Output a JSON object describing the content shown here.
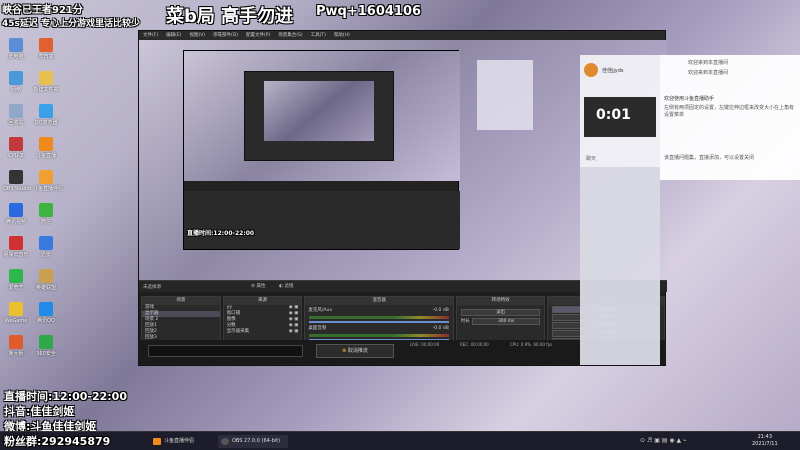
{
  "stream_overlay": {
    "rank_line": "峡谷已王者921分",
    "delay_line": "45s延迟 专心上分游戏里话比较少",
    "title_big": "菜b局 高手勿进",
    "qq_group": "Pwq+1604106",
    "schedule": "直播时间:12:00-22:00",
    "douyin": "抖音:佳佳剑姬",
    "weibo": "微博:斗鱼佳佳剑姬",
    "fans": "粉丝群:292945879"
  },
  "desktop_icons": [
    {
      "label": "此电脑",
      "color": "#5a8fd8"
    },
    {
      "label": "向日葵",
      "color": "#e06030"
    },
    {
      "label": "网络",
      "color": "#4a9ad8"
    },
    {
      "label": "新建文件夹",
      "color": "#e8c050"
    },
    {
      "label": "回收站",
      "color": "#8fa8c8"
    },
    {
      "label": "QQ浏览器",
      "color": "#3aa0e8"
    },
    {
      "label": "CPU-Z",
      "color": "#c03a3a"
    },
    {
      "label": "斗鱼直播",
      "color": "#f08a1e"
    },
    {
      "label": "OBS Studio",
      "color": "#333"
    },
    {
      "label": "斗鱼直播伴侣",
      "color": "#f0a030"
    },
    {
      "label": "腾讯视频",
      "color": "#2a6ae0"
    },
    {
      "label": "微信",
      "color": "#3fb33f"
    },
    {
      "label": "网易云音乐",
      "color": "#d03030"
    },
    {
      "label": "迅雷",
      "color": "#3a7ae0"
    },
    {
      "label": "爱奇艺",
      "color": "#2fb84a"
    },
    {
      "label": "英雄联盟",
      "color": "#c8a050"
    },
    {
      "label": "WeGame",
      "color": "#e8c030"
    },
    {
      "label": "腾讯QQ",
      "color": "#1f8ae8"
    },
    {
      "label": "鲁大师",
      "color": "#e05a2a"
    },
    {
      "label": "360安全",
      "color": "#2fa84a"
    }
  ],
  "obs": {
    "menu": [
      "文件(F)",
      "编辑(E)",
      "视图(V)",
      "停靠部件(D)",
      "配置文件(P)",
      "场景集合(S)",
      "工具(T)",
      "帮助(H)"
    ],
    "status_text": "未选择源",
    "status_btn1": "属性",
    "status_btn2": "滤镜",
    "docks": {
      "scenes_title": "场景",
      "sources_title": "来源",
      "mixer_title": "混音器",
      "transitions_title": "转场特效",
      "controls_title": "控件"
    },
    "scenes": [
      "游戏",
      "显示器",
      "场景 2",
      "回放1",
      "回放2",
      "回放3"
    ],
    "sources": [
      "yy",
      "窗口捕",
      "图像",
      "分数",
      "显示器采集"
    ],
    "mixer": [
      {
        "name": "麦克风/Aux",
        "db": "-0.0 dB"
      },
      {
        "name": "桌面音频",
        "db": "-0.0 dB"
      }
    ],
    "transition": {
      "type": "淡出",
      "duration_label": "时长",
      "duration": "300 ms"
    },
    "controls": [
      "停止推流",
      "开始录制",
      "启动虚拟摄像机",
      "工作室模式",
      "设置",
      "退出"
    ],
    "studio_btn": "取消推流",
    "statusbar": {
      "live": "LIVE: 00:00:00",
      "rec": "REC: 00:00:00",
      "cpu": "CPU: 0.9%, 60.00 fps"
    }
  },
  "chat": {
    "user": "佳佳jjyds",
    "timer": "0:01",
    "welcome_lines": [
      "欢迎来到本直播间",
      "欢迎来到本直播间"
    ],
    "notice_title": "欢迎使用斗鱼直播助手",
    "notice_body": "左侧有两项固定的设置，左键拉伸边框来改变大小在上角有设置菜单",
    "tips": "该直播问题集，直接添加，可以设置关闭",
    "chat_tab": "聊天"
  },
  "taskbar": {
    "items": [
      "斗鱼直播伴侣",
      "OBS 27.0.0 (64-bit)"
    ],
    "time": "21:43",
    "date": "2021/7/11"
  },
  "colors": {
    "obs_bg": "#1e1e1e",
    "overlay_text": "#ffffff",
    "chat_bg": "#ebebf5"
  }
}
